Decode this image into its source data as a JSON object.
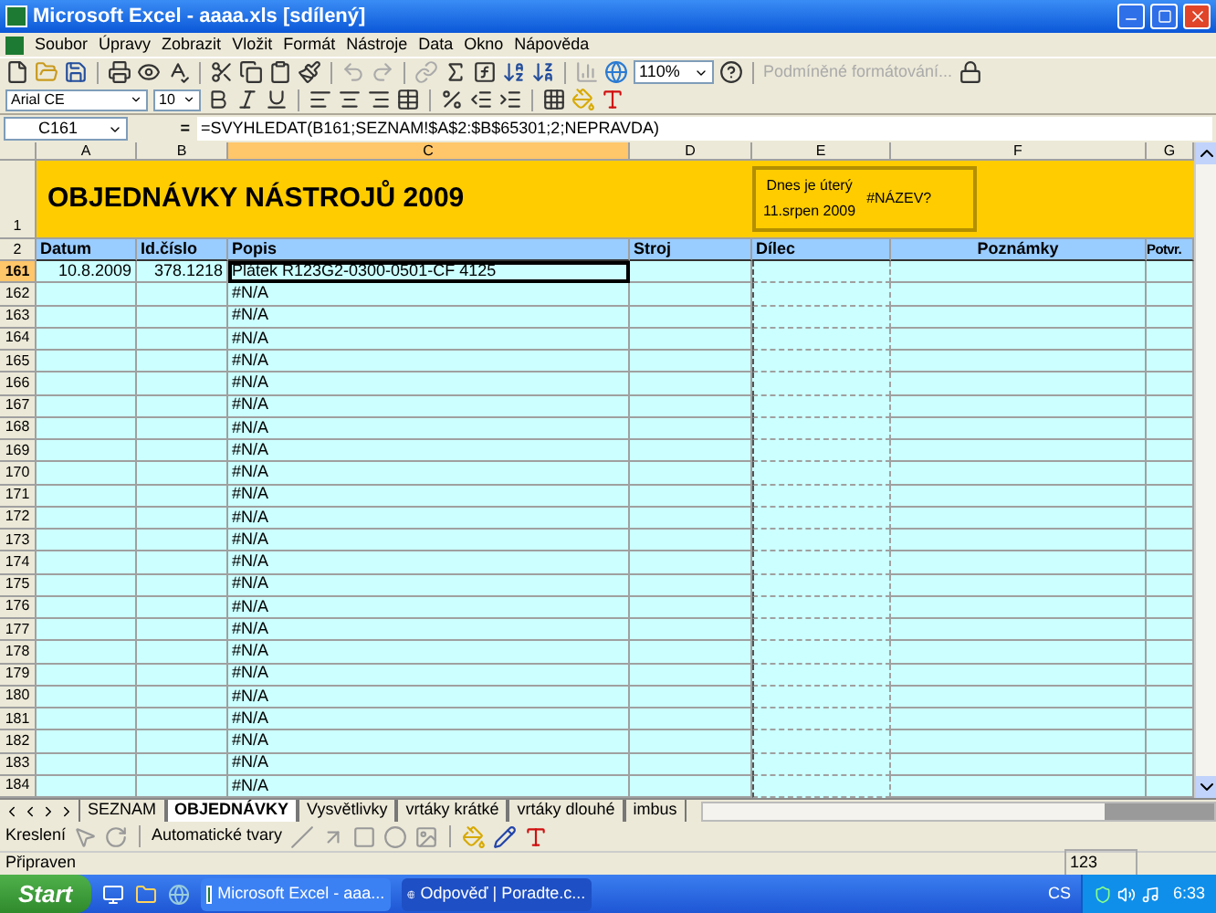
{
  "window": {
    "title": "Microsoft Excel - aaaa.xls  [sdílený]"
  },
  "menu": [
    "Soubor",
    "Úpravy",
    "Zobrazit",
    "Vložit",
    "Formát",
    "Nástroje",
    "Data",
    "Okno",
    "Nápověda"
  ],
  "toolbar": {
    "zoom": "110%",
    "conditional_format": "Podmíněné formátování..."
  },
  "format_bar": {
    "font": "Arial CE",
    "size": "10"
  },
  "formula_bar": {
    "name_box": "C161",
    "equals": "=",
    "formula": "=SVYHLEDAT(B161;SEZNAM!$A$2:$B$65301;2;NEPRAVDA)"
  },
  "columns": [
    "A",
    "B",
    "C",
    "D",
    "E",
    "F",
    "G"
  ],
  "title_row": {
    "number": "1",
    "title": "OBJEDNÁVKY NÁSTROJŮ 2009",
    "info_line_1": "Dnes je úterý",
    "info_line_2": "11.srpen 2009",
    "info_error": "#NÁZEV?"
  },
  "header_row": {
    "number": "2",
    "labels": [
      "Datum",
      "Id.číslo",
      "Popis",
      "Stroj",
      "Dílec",
      "Poznámky",
      "Potvr."
    ]
  },
  "rows": [
    {
      "number": "161",
      "selected": true,
      "datum": "10.8.2009",
      "id": "378.1218",
      "popis": "Plátek  R123G2-0300-0501-CF  4125"
    },
    {
      "number": "162",
      "selected": false,
      "popis": "#N/A"
    },
    {
      "number": "163",
      "selected": false,
      "popis": "#N/A"
    },
    {
      "number": "164",
      "selected": false,
      "popis": "#N/A"
    },
    {
      "number": "165",
      "selected": false,
      "popis": "#N/A"
    },
    {
      "number": "166",
      "selected": false,
      "popis": "#N/A"
    },
    {
      "number": "167",
      "selected": false,
      "popis": "#N/A"
    },
    {
      "number": "168",
      "selected": false,
      "popis": "#N/A"
    },
    {
      "number": "169",
      "selected": false,
      "popis": "#N/A"
    },
    {
      "number": "170",
      "selected": false,
      "popis": "#N/A"
    },
    {
      "number": "171",
      "selected": false,
      "popis": "#N/A"
    },
    {
      "number": "172",
      "selected": false,
      "popis": "#N/A"
    },
    {
      "number": "173",
      "selected": false,
      "popis": "#N/A"
    },
    {
      "number": "174",
      "selected": false,
      "popis": "#N/A"
    },
    {
      "number": "175",
      "selected": false,
      "popis": "#N/A"
    },
    {
      "number": "176",
      "selected": false,
      "popis": "#N/A"
    },
    {
      "number": "177",
      "selected": false,
      "popis": "#N/A"
    },
    {
      "number": "178",
      "selected": false,
      "popis": "#N/A"
    },
    {
      "number": "179",
      "selected": false,
      "popis": "#N/A"
    },
    {
      "number": "180",
      "selected": false,
      "popis": "#N/A"
    },
    {
      "number": "181",
      "selected": false,
      "popis": "#N/A"
    },
    {
      "number": "182",
      "selected": false,
      "popis": "#N/A"
    },
    {
      "number": "183",
      "selected": false,
      "popis": "#N/A"
    },
    {
      "number": "184",
      "selected": false,
      "popis": "#N/A"
    }
  ],
  "sheet_tabs": [
    {
      "label": "SEZNAM",
      "selected": false
    },
    {
      "label": "OBJEDNÁVKY",
      "selected": true
    },
    {
      "label": "Vysvětlivky",
      "selected": false
    },
    {
      "label": "vrtáky krátké",
      "selected": false
    },
    {
      "label": "vrtáky dlouhé",
      "selected": false
    },
    {
      "label": "imbus",
      "selected": false
    }
  ],
  "drawing_bar": {
    "draw": "Kreslení",
    "autoshapes": "Automatické tvary"
  },
  "status_bar": {
    "text": "Připraven",
    "num": "123"
  },
  "taskbar": {
    "start": "Start",
    "tasks": [
      {
        "label": "Microsoft Excel - aaa...",
        "selected": false,
        "kind": "excel"
      },
      {
        "label": "Odpověď | Poradte.c...",
        "selected": true,
        "kind": "browser"
      }
    ],
    "language": "CS",
    "time": "6:33"
  }
}
